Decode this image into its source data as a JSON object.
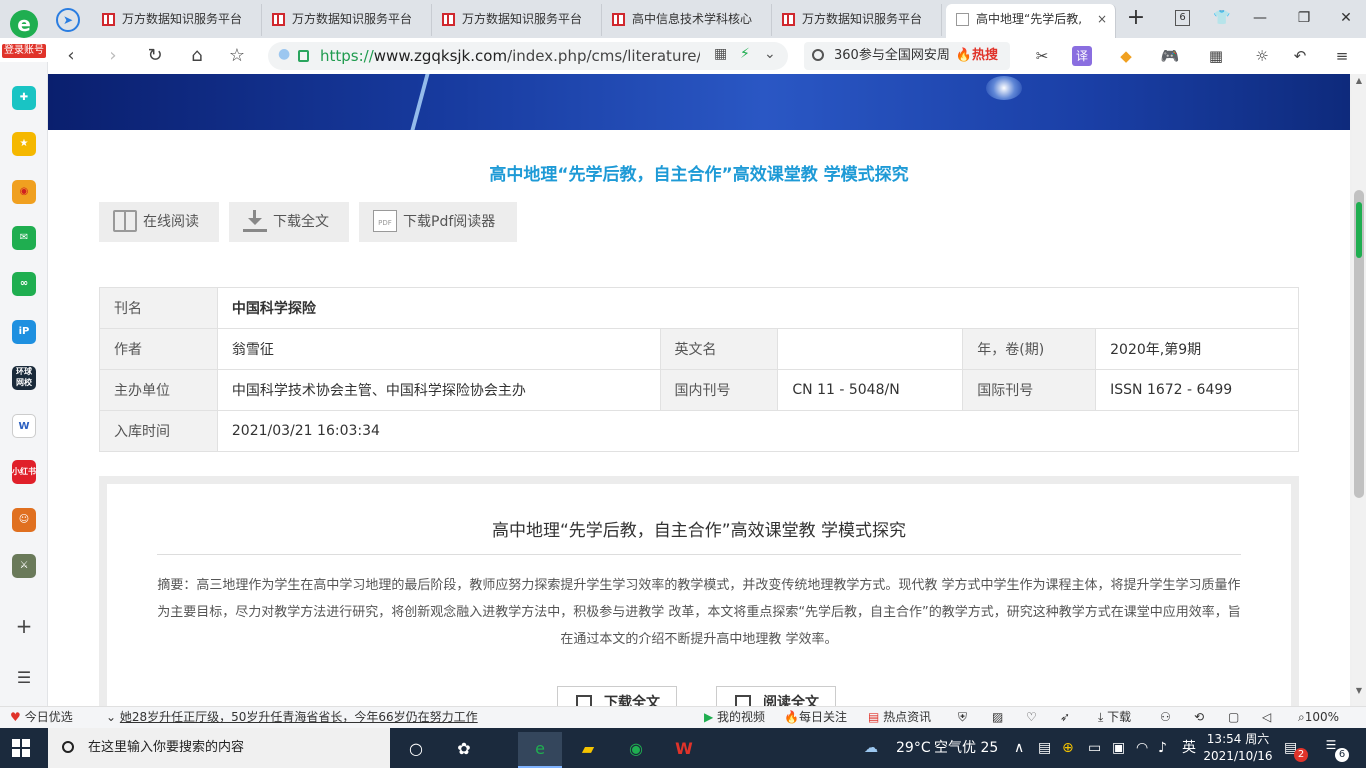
{
  "browser": {
    "login_badge": "登录账号",
    "tabs": [
      {
        "title": "万方数据知识服务平台"
      },
      {
        "title": "万方数据知识服务平台"
      },
      {
        "title": "万方数据知识服务平台"
      },
      {
        "title": "高中信息技术学科核心"
      },
      {
        "title": "万方数据知识服务平台"
      },
      {
        "title": "高中地理“先学后教,"
      }
    ],
    "tab_count": "6",
    "url_scheme": "https://",
    "url_host": "www.zgqksjk.com",
    "url_path": "/index.php/cms/literature/show",
    "search_placeholder": "360参与全国网安周",
    "search_hot": "🔥热搜"
  },
  "article": {
    "title": "高中地理“先学后教，自主合作”高效课堂教 学模式探究",
    "actions": {
      "read_online": "在线阅读",
      "download_full": "下载全文",
      "download_pdf_reader": "下载Pdf阅读器"
    },
    "meta": {
      "journal_label": "刊名",
      "journal_value": "中国科学探险",
      "author_label": "作者",
      "author_value": "翁雪征",
      "english_name_label": "英文名",
      "english_name_value": "",
      "year_vol_label": "年，卷(期)",
      "year_vol_value": "2020年,第9期",
      "sponsor_label": "主办单位",
      "sponsor_value": "中国科学技术协会主管、中国科学探险协会主办",
      "cn_label": "国内刊号",
      "cn_value": "CN 11 - 5048/N",
      "issn_label": "国际刊号",
      "issn_value": "ISSN 1672 - 6499",
      "indexed_label": "入库时间",
      "indexed_value": "2021/03/21 16:03:34"
    },
    "abstract_title": "高中地理“先学后教，自主合作”高效课堂教 学模式探究",
    "abstract": "摘要：高三地理作为学生在高中学习地理的最后阶段，教师应努力探索提升学生学习效率的教学模式，并改变传统地理教学方式。现代教 学方式中学生作为课程主体，将提升学生学习质量作为主要目标，尽力对教学方法进行研究，将创新观念融入进教学方法中，积极参与进教学 改革，本文将重点探索“先学后教，自主合作”的教学方式，研究这种教学方式在课堂中应用效率，旨在通过本文的介绍不断提升高中地理教 学效率。",
    "bottom_download": "下载全文",
    "bottom_read": "阅读全文"
  },
  "statusbar": {
    "today_pick": "今日优选",
    "news": "她28岁升任正厅级，50岁升任青海省省长，今年66岁仍在努力工作",
    "my_video": "我的视频",
    "daily_follow": "每日关注",
    "hot_news": "热点资讯",
    "download": "下载",
    "zoom": "100%"
  },
  "taskbar": {
    "search_placeholder": "在这里输入你要搜索的内容",
    "weather": "29°C",
    "air": "空气优 25",
    "ime": "英",
    "time": "13:54 周六",
    "date": "2021/10/16",
    "notification_count": "6",
    "mail_count": "2"
  }
}
